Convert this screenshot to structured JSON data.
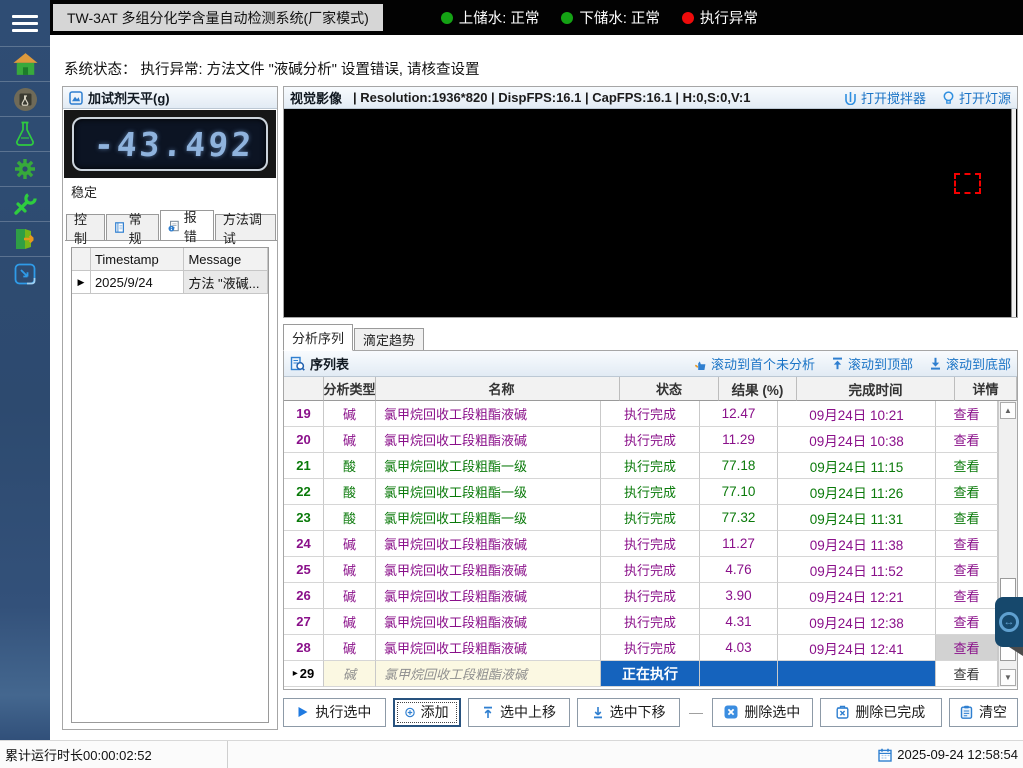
{
  "titlebar": {
    "title": "TW-3AT 多组分化学含量自动检测系统(厂家模式)",
    "indicators": [
      {
        "label": "上储水: 正常",
        "color": "#14a214"
      },
      {
        "label": "下储水: 正常",
        "color": "#14a214"
      },
      {
        "label": "执行异常",
        "color": "#ee0b0b"
      }
    ]
  },
  "sidebar": {
    "icons": [
      "menu-icon",
      "home-icon",
      "balance-monitor-icon",
      "flask-icon",
      "settings-gear-icon",
      "maintenance-wrench-icon",
      "exit-door-icon",
      "minimize-window-icon"
    ]
  },
  "status_line": "系统状态：  执行异常: 方法文件 \"液碱分析\" 设置错误, 请核查设置",
  "balance": {
    "title": "加试剂天平(g)",
    "value": "-43.492",
    "state": "稳定"
  },
  "left_tabs": [
    {
      "label": "控制"
    },
    {
      "label": "常规"
    },
    {
      "label": "报错",
      "selected": true
    },
    {
      "label": "方法调试"
    }
  ],
  "error_table": {
    "columns": {
      "timestamp": "Timestamp",
      "message": "Message"
    },
    "row": {
      "marker": "▶",
      "timestamp": "2025/9/24",
      "message": "方法 \"液碱..."
    }
  },
  "video": {
    "title": "视觉影像",
    "info": "| Resolution:1936*820 | DispFPS:16.1 | CapFPS:16.1 | H:0,S:0,V:1",
    "stirrer_label": "打开搅拌器",
    "light_label": "打开灯源"
  },
  "seq_tabs": [
    {
      "label": "分析序列",
      "selected": true
    },
    {
      "label": "滴定趋势"
    }
  ],
  "sequence": {
    "title": "序列表",
    "links": [
      {
        "label": "滚动到首个未分析"
      },
      {
        "label": "滚动到顶部"
      },
      {
        "label": "滚动到底部"
      }
    ],
    "columns": [
      "分析类型",
      "名称",
      "状态",
      "结果 (%)",
      "完成时间",
      "详情"
    ],
    "colors": {
      "alkali": "#8a108a",
      "acid": "#0a7a0a",
      "running_bg": "#1563bd",
      "pending_bg": "#fbf8e2"
    },
    "rows": [
      {
        "num": "19",
        "type": "碱",
        "name": "氯甲烷回收工段粗酯液碱",
        "status": "执行完成",
        "result": "12.47",
        "time": "09月24日 10:21",
        "detail": "查看",
        "style": "alkali"
      },
      {
        "num": "20",
        "type": "碱",
        "name": "氯甲烷回收工段粗酯液碱",
        "status": "执行完成",
        "result": "11.29",
        "time": "09月24日 10:38",
        "detail": "查看",
        "style": "alkali"
      },
      {
        "num": "21",
        "type": "酸",
        "name": "氯甲烷回收工段粗酯一级",
        "status": "执行完成",
        "result": "77.18",
        "time": "09月24日 11:15",
        "detail": "查看",
        "style": "acid"
      },
      {
        "num": "22",
        "type": "酸",
        "name": "氯甲烷回收工段粗酯一级",
        "status": "执行完成",
        "result": "77.10",
        "time": "09月24日 11:26",
        "detail": "查看",
        "style": "acid"
      },
      {
        "num": "23",
        "type": "酸",
        "name": "氯甲烷回收工段粗酯一级",
        "status": "执行完成",
        "result": "77.32",
        "time": "09月24日 11:31",
        "detail": "查看",
        "style": "acid"
      },
      {
        "num": "24",
        "type": "碱",
        "name": "氯甲烷回收工段粗酯液碱",
        "status": "执行完成",
        "result": "11.27",
        "time": "09月24日 11:38",
        "detail": "查看",
        "style": "alkali"
      },
      {
        "num": "25",
        "type": "碱",
        "name": "氯甲烷回收工段粗酯液碱",
        "status": "执行完成",
        "result": "4.76",
        "time": "09月24日 11:52",
        "detail": "查看",
        "style": "alkali"
      },
      {
        "num": "26",
        "type": "碱",
        "name": "氯甲烷回收工段粗酯液碱",
        "status": "执行完成",
        "result": "3.90",
        "time": "09月24日 12:21",
        "detail": "查看",
        "style": "alkali"
      },
      {
        "num": "27",
        "type": "碱",
        "name": "氯甲烷回收工段粗酯液碱",
        "status": "执行完成",
        "result": "4.31",
        "time": "09月24日 12:38",
        "detail": "查看",
        "style": "alkali"
      },
      {
        "num": "28",
        "type": "碱",
        "name": "氯甲烷回收工段粗酯液碱",
        "status": "执行完成",
        "result": "4.03",
        "time": "09月24日 12:41",
        "detail": "查看",
        "style": "alkali",
        "detail_selected": true
      },
      {
        "num": "29",
        "type": "碱",
        "name": "氯甲烷回收工段粗酯液碱",
        "status": "正在执行",
        "result": "",
        "time": "",
        "detail": "查看",
        "style": "running",
        "marker": true
      }
    ]
  },
  "actions": [
    {
      "label": "执行选中"
    },
    {
      "label": "添加",
      "focused": true
    },
    {
      "label": "选中上移"
    },
    {
      "label": "选中下移"
    },
    {
      "label": "删除选中"
    },
    {
      "label": "删除已完成"
    },
    {
      "label": "清空"
    }
  ],
  "actions_separator": "—",
  "statusbar": {
    "runtime": "累计运行时长00:00:02:52",
    "datetime": "2025-09-24 12:58:54"
  }
}
